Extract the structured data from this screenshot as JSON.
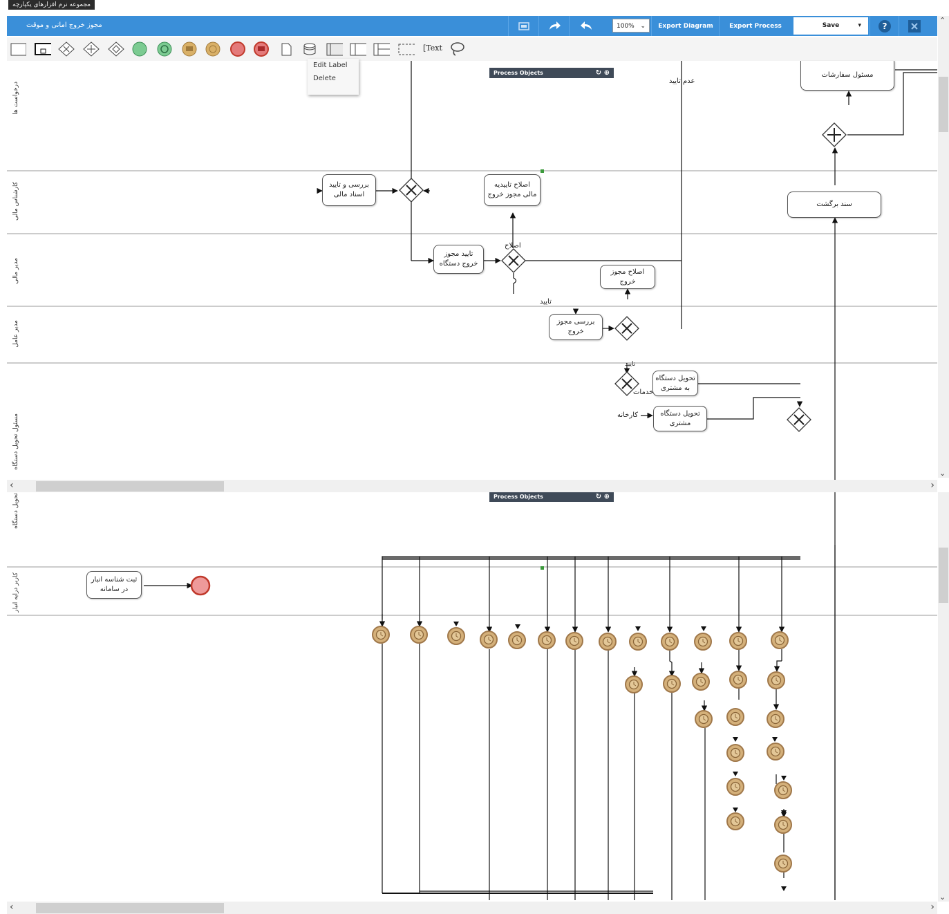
{
  "window": {
    "top_label": "مجموعه نرم افزارهای یکپارچه"
  },
  "header": {
    "process_title": "مجوز خروج امانی و موقت",
    "zoom": "100%",
    "export_diagram": "Export Diagram",
    "export_process": "Export Process",
    "save": "Save"
  },
  "context_menu": {
    "edit_label": "Edit Label",
    "delete": "Delete"
  },
  "panels": {
    "process_objects": "Process Objects"
  },
  "palette": {
    "text_tool": "Text"
  },
  "lanes": [
    "درخواست ها",
    "کارشناس مالی",
    "مدیر مالی",
    "مدیر عامل",
    "مسئول تحویل دستگاه",
    "تحویل دستگاه",
    "کاربر درایه انبار"
  ],
  "tasks": {
    "orders_manager": "مسئول سفارشات",
    "review_finance_docs_1": "بررسی و تایید",
    "review_finance_docs_2": "اسناد مالی",
    "fix_finance_1": "اصلاح تاییدیه",
    "fix_finance_2": "مالی مجوز خروج",
    "return_doc": "سند برگشت",
    "approve_exit_1": "تایید مجوز",
    "approve_exit_2": "خروج دستگاه",
    "fix_exit_1": "اصلاح مجوز",
    "fix_exit_2": "خروج",
    "review_exit_1": "بررسی مجوز",
    "review_exit_2": "خروج",
    "deliver_customer_1": "تحویل دستگاه",
    "deliver_customer_2": "به مشتری",
    "deliver_customer_b1": "تحویل دستگاه",
    "deliver_customer_b2": "مشتری",
    "register_stock_1": "ثبت شناسه انبار",
    "register_stock_2": "در سامانه"
  },
  "flow_labels": {
    "not_approved": "عدم تایید",
    "fix": "اصلاح",
    "approve": "تایید",
    "services": "خدمات",
    "factory": "کارخانه",
    "top_small": "تایید"
  },
  "colors": {
    "header": "#3a8fd9",
    "timer_fill": "#d4b07a",
    "timer_stroke": "#a0784a",
    "end_event": "#d94a4a",
    "start_event": "#5fba7d"
  }
}
